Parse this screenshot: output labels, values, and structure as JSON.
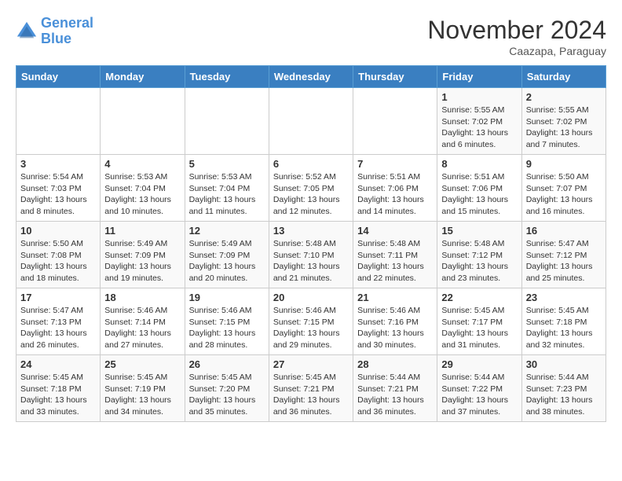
{
  "logo": {
    "line1": "General",
    "line2": "Blue"
  },
  "title": "November 2024",
  "subtitle": "Caazapa, Paraguay",
  "weekdays": [
    "Sunday",
    "Monday",
    "Tuesday",
    "Wednesday",
    "Thursday",
    "Friday",
    "Saturday"
  ],
  "weeks": [
    [
      {
        "day": "",
        "text": ""
      },
      {
        "day": "",
        "text": ""
      },
      {
        "day": "",
        "text": ""
      },
      {
        "day": "",
        "text": ""
      },
      {
        "day": "",
        "text": ""
      },
      {
        "day": "1",
        "text": "Sunrise: 5:55 AM\nSunset: 7:02 PM\nDaylight: 13 hours and 6 minutes."
      },
      {
        "day": "2",
        "text": "Sunrise: 5:55 AM\nSunset: 7:02 PM\nDaylight: 13 hours and 7 minutes."
      }
    ],
    [
      {
        "day": "3",
        "text": "Sunrise: 5:54 AM\nSunset: 7:03 PM\nDaylight: 13 hours and 8 minutes."
      },
      {
        "day": "4",
        "text": "Sunrise: 5:53 AM\nSunset: 7:04 PM\nDaylight: 13 hours and 10 minutes."
      },
      {
        "day": "5",
        "text": "Sunrise: 5:53 AM\nSunset: 7:04 PM\nDaylight: 13 hours and 11 minutes."
      },
      {
        "day": "6",
        "text": "Sunrise: 5:52 AM\nSunset: 7:05 PM\nDaylight: 13 hours and 12 minutes."
      },
      {
        "day": "7",
        "text": "Sunrise: 5:51 AM\nSunset: 7:06 PM\nDaylight: 13 hours and 14 minutes."
      },
      {
        "day": "8",
        "text": "Sunrise: 5:51 AM\nSunset: 7:06 PM\nDaylight: 13 hours and 15 minutes."
      },
      {
        "day": "9",
        "text": "Sunrise: 5:50 AM\nSunset: 7:07 PM\nDaylight: 13 hours and 16 minutes."
      }
    ],
    [
      {
        "day": "10",
        "text": "Sunrise: 5:50 AM\nSunset: 7:08 PM\nDaylight: 13 hours and 18 minutes."
      },
      {
        "day": "11",
        "text": "Sunrise: 5:49 AM\nSunset: 7:09 PM\nDaylight: 13 hours and 19 minutes."
      },
      {
        "day": "12",
        "text": "Sunrise: 5:49 AM\nSunset: 7:09 PM\nDaylight: 13 hours and 20 minutes."
      },
      {
        "day": "13",
        "text": "Sunrise: 5:48 AM\nSunset: 7:10 PM\nDaylight: 13 hours and 21 minutes."
      },
      {
        "day": "14",
        "text": "Sunrise: 5:48 AM\nSunset: 7:11 PM\nDaylight: 13 hours and 22 minutes."
      },
      {
        "day": "15",
        "text": "Sunrise: 5:48 AM\nSunset: 7:12 PM\nDaylight: 13 hours and 23 minutes."
      },
      {
        "day": "16",
        "text": "Sunrise: 5:47 AM\nSunset: 7:12 PM\nDaylight: 13 hours and 25 minutes."
      }
    ],
    [
      {
        "day": "17",
        "text": "Sunrise: 5:47 AM\nSunset: 7:13 PM\nDaylight: 13 hours and 26 minutes."
      },
      {
        "day": "18",
        "text": "Sunrise: 5:46 AM\nSunset: 7:14 PM\nDaylight: 13 hours and 27 minutes."
      },
      {
        "day": "19",
        "text": "Sunrise: 5:46 AM\nSunset: 7:15 PM\nDaylight: 13 hours and 28 minutes."
      },
      {
        "day": "20",
        "text": "Sunrise: 5:46 AM\nSunset: 7:15 PM\nDaylight: 13 hours and 29 minutes."
      },
      {
        "day": "21",
        "text": "Sunrise: 5:46 AM\nSunset: 7:16 PM\nDaylight: 13 hours and 30 minutes."
      },
      {
        "day": "22",
        "text": "Sunrise: 5:45 AM\nSunset: 7:17 PM\nDaylight: 13 hours and 31 minutes."
      },
      {
        "day": "23",
        "text": "Sunrise: 5:45 AM\nSunset: 7:18 PM\nDaylight: 13 hours and 32 minutes."
      }
    ],
    [
      {
        "day": "24",
        "text": "Sunrise: 5:45 AM\nSunset: 7:18 PM\nDaylight: 13 hours and 33 minutes."
      },
      {
        "day": "25",
        "text": "Sunrise: 5:45 AM\nSunset: 7:19 PM\nDaylight: 13 hours and 34 minutes."
      },
      {
        "day": "26",
        "text": "Sunrise: 5:45 AM\nSunset: 7:20 PM\nDaylight: 13 hours and 35 minutes."
      },
      {
        "day": "27",
        "text": "Sunrise: 5:45 AM\nSunset: 7:21 PM\nDaylight: 13 hours and 36 minutes."
      },
      {
        "day": "28",
        "text": "Sunrise: 5:44 AM\nSunset: 7:21 PM\nDaylight: 13 hours and 36 minutes."
      },
      {
        "day": "29",
        "text": "Sunrise: 5:44 AM\nSunset: 7:22 PM\nDaylight: 13 hours and 37 minutes."
      },
      {
        "day": "30",
        "text": "Sunrise: 5:44 AM\nSunset: 7:23 PM\nDaylight: 13 hours and 38 minutes."
      }
    ]
  ]
}
